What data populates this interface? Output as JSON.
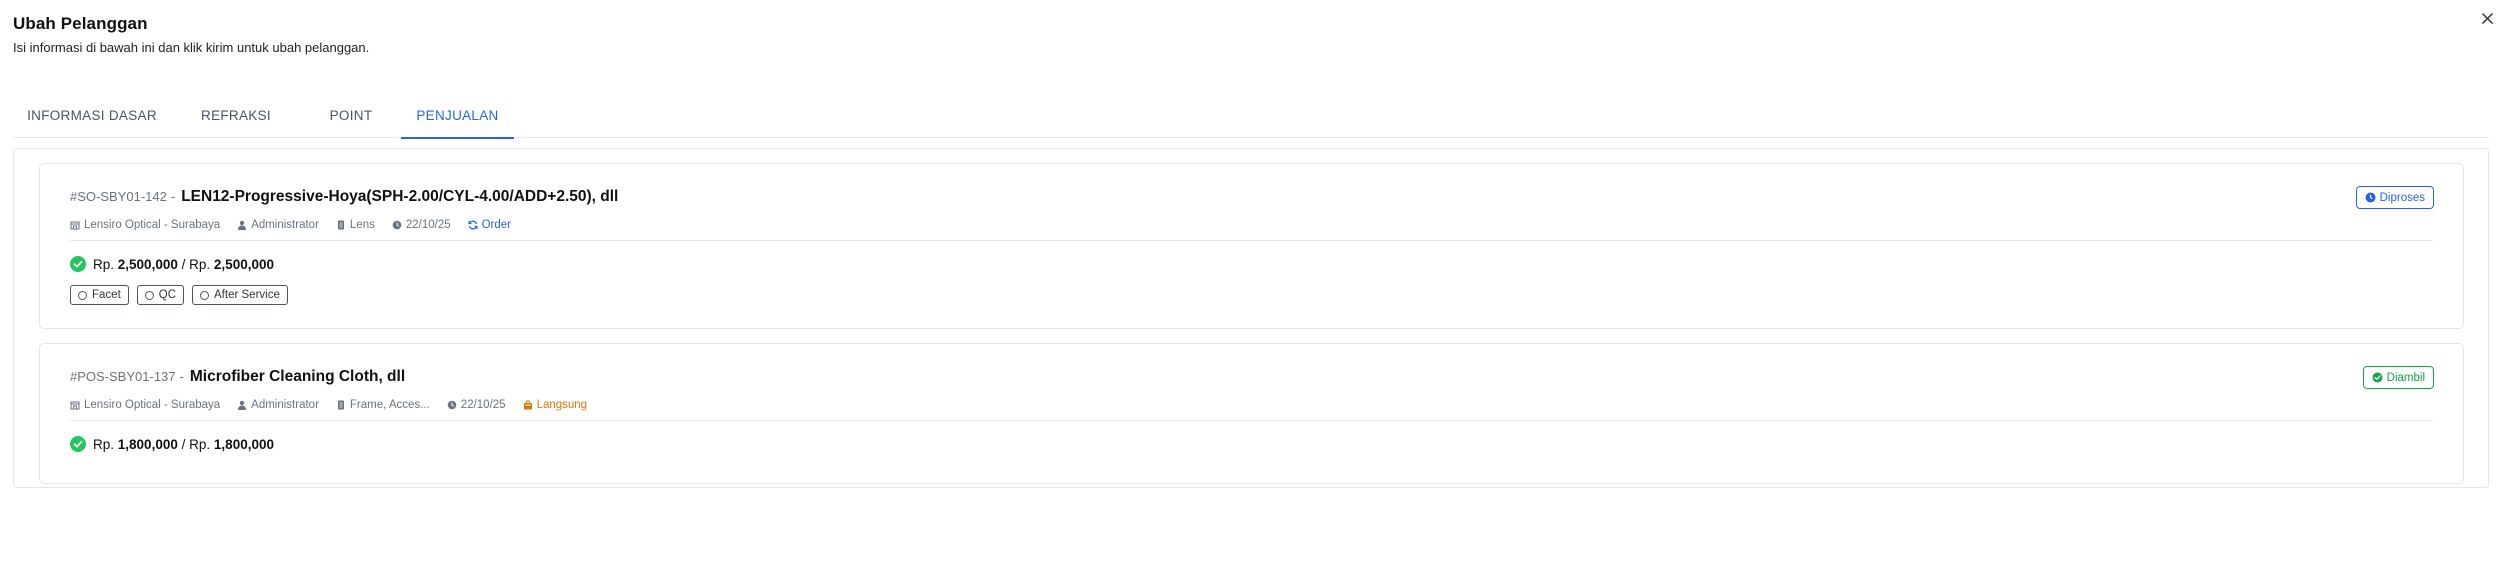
{
  "dialog": {
    "title": "Ubah Pelanggan",
    "subtitle": "Isi informasi di bawah ini dan klik kirim untuk ubah pelanggan."
  },
  "tabs": [
    {
      "label": "INFORMASI DASAR",
      "active": false
    },
    {
      "label": "REFRAKSI",
      "active": false
    },
    {
      "label": "POINT",
      "active": false
    },
    {
      "label": "PENJUALAN",
      "active": true
    }
  ],
  "sales": [
    {
      "id": "#SO-SBY01-142",
      "sep": "-",
      "name": "LEN12-Progressive-Hoya(SPH-2.00/CYL-4.00/ADD+2.50), dll",
      "store": "Lensiro Optical - Surabaya",
      "user": "Administrator",
      "category": "Lens",
      "date": "22/10/25",
      "type": "Order",
      "price_prefix": "Rp.",
      "paid": "2,500,000",
      "slash": "/",
      "total_prefix": "Rp.",
      "total": "2,500,000",
      "status": "Diproses",
      "status_color": "#2563eb",
      "chips": [
        "Facet",
        "QC",
        "After Service"
      ]
    },
    {
      "id": "#POS-SBY01-137",
      "sep": "-",
      "name": "Microfiber Cleaning Cloth, dll",
      "store": "Lensiro Optical - Surabaya",
      "user": "Administrator",
      "category": "Frame, Acces...",
      "date": "22/10/25",
      "type": "Langsung",
      "price_prefix": "Rp.",
      "paid": "1,800,000",
      "slash": "/",
      "total_prefix": "Rp.",
      "total": "1,800,000",
      "status": "Diambil",
      "status_color": "#16a34a"
    }
  ],
  "icons": {
    "close": "close-icon",
    "store": "store-icon",
    "user": "user-icon",
    "category": "document-icon",
    "date": "clock-icon",
    "order": "refresh-icon",
    "direct": "bag-icon",
    "paid": "check-circle-icon"
  },
  "colors": {
    "accent": "#2563eb",
    "success": "#16a34a",
    "warning": "#d97706",
    "check": "#22c55e"
  }
}
